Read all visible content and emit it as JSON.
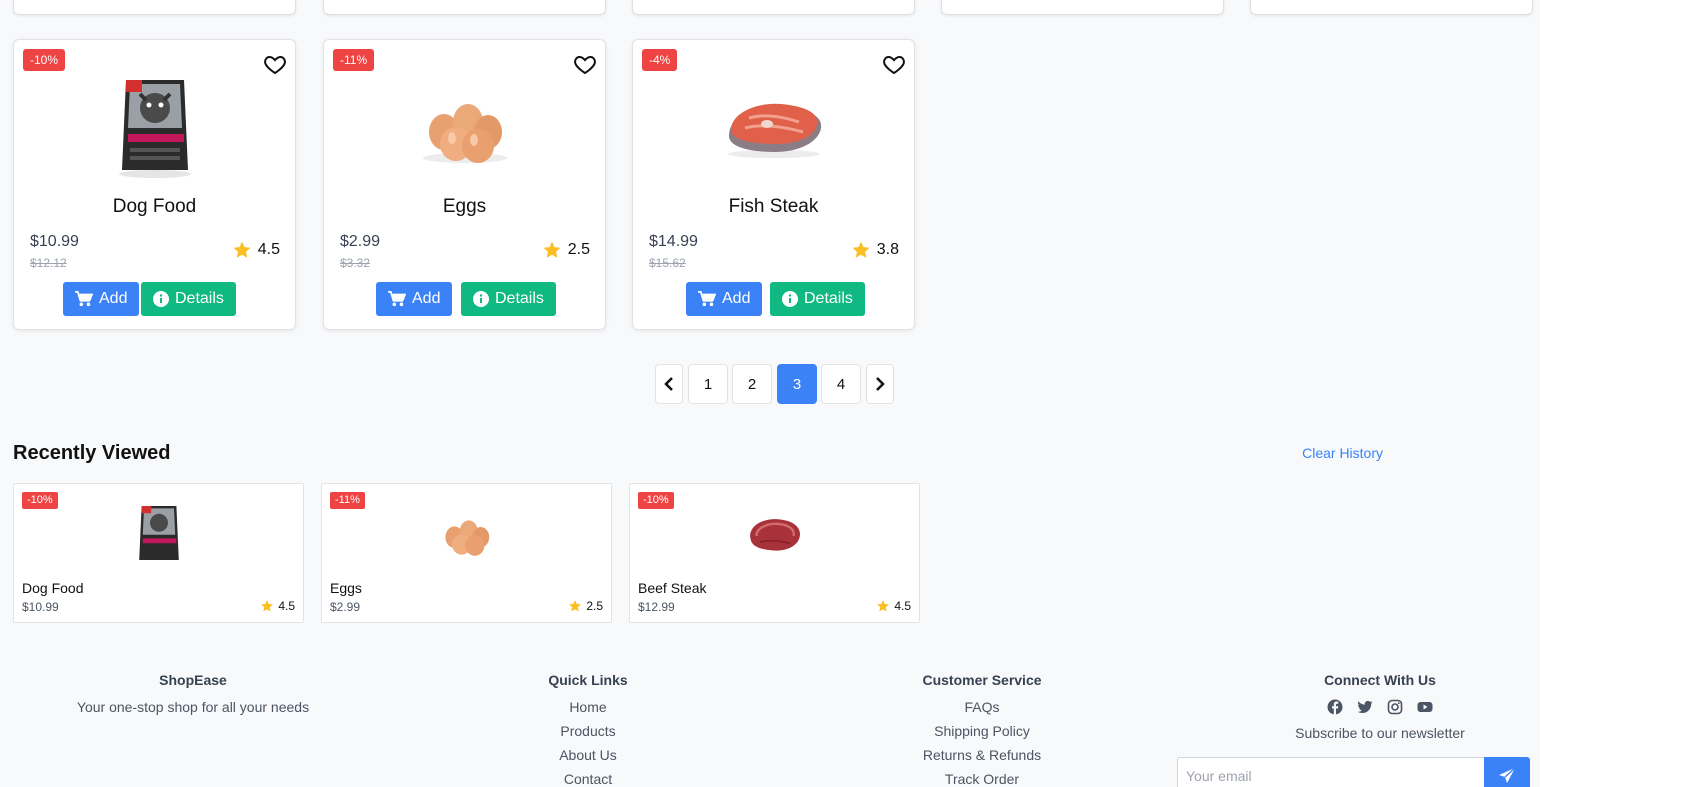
{
  "products": [
    {
      "badge": "-10%",
      "name": "Dog Food",
      "price": "$10.99",
      "old_price": "$12.12",
      "rating": "4.5",
      "image": "dog-food-bag"
    },
    {
      "badge": "-11%",
      "name": "Eggs",
      "price": "$2.99",
      "old_price": "$3.32",
      "rating": "2.5",
      "image": "eggs"
    },
    {
      "badge": "-4%",
      "name": "Fish Steak",
      "price": "$14.99",
      "old_price": "$15.62",
      "rating": "3.8",
      "image": "fish-steak"
    }
  ],
  "buttons": {
    "add": "Add",
    "details": "Details"
  },
  "pagination": {
    "pages": [
      "1",
      "2",
      "3",
      "4"
    ],
    "current": "3"
  },
  "recently_viewed": {
    "title": "Recently Viewed",
    "clear_label": "Clear History",
    "items": [
      {
        "badge": "-10%",
        "name": "Dog Food",
        "price": "$10.99",
        "rating": "4.5",
        "image": "dog-food-bag"
      },
      {
        "badge": "-11%",
        "name": "Eggs",
        "price": "$2.99",
        "rating": "2.5",
        "image": "eggs"
      },
      {
        "badge": "-10%",
        "name": "Beef Steak",
        "price": "$12.99",
        "rating": "4.5",
        "image": "beef-steak"
      }
    ]
  },
  "footer": {
    "brand": {
      "title": "ShopEase",
      "tagline": "Your one-stop shop for all your needs"
    },
    "quick_links": {
      "title": "Quick Links",
      "links": [
        "Home",
        "Products",
        "About Us",
        "Contact"
      ]
    },
    "customer_service": {
      "title": "Customer Service",
      "links": [
        "FAQs",
        "Shipping Policy",
        "Returns & Refunds",
        "Track Order"
      ]
    },
    "connect": {
      "title": "Connect With Us",
      "socials": [
        "facebook-icon",
        "twitter-icon",
        "instagram-icon",
        "youtube-icon"
      ],
      "newsletter_text": "Subscribe to our newsletter",
      "email_placeholder": "Your email"
    }
  },
  "colors": {
    "primary": "#3b82f6",
    "success": "#10b981",
    "danger": "#ef4444",
    "star": "#fbbf24"
  }
}
